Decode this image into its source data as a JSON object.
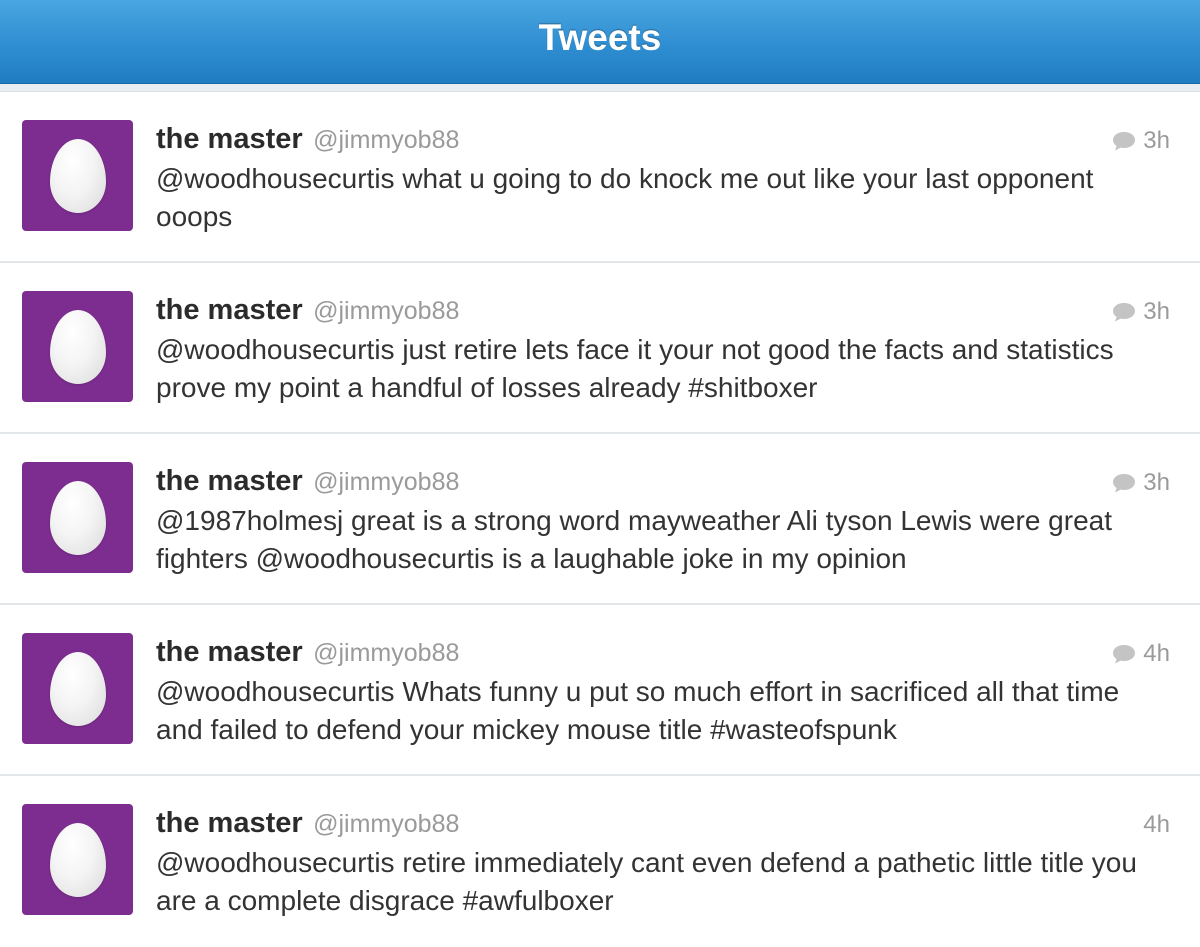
{
  "header": {
    "title": "Tweets"
  },
  "tweets": [
    {
      "name": "the master",
      "handle": "@jimmyob88",
      "time": "3h",
      "has_reply_icon": true,
      "text": "@woodhousecurtis what u going to do knock me out like your last opponent ooops"
    },
    {
      "name": "the master",
      "handle": "@jimmyob88",
      "time": "3h",
      "has_reply_icon": true,
      "text": "@woodhousecurtis just retire lets face it your not good the facts and statistics prove my point a handful of losses already #shitboxer"
    },
    {
      "name": "the master",
      "handle": "@jimmyob88",
      "time": "3h",
      "has_reply_icon": true,
      "text": "@1987holmesj great is a strong word mayweather Ali tyson Lewis were great fighters @woodhousecurtis is a laughable joke in my opinion"
    },
    {
      "name": "the master",
      "handle": "@jimmyob88",
      "time": "4h",
      "has_reply_icon": true,
      "text": "@woodhousecurtis Whats funny u put so much effort in sacrificed all that time and failed to defend your mickey mouse title #wasteofspunk"
    },
    {
      "name": "the master",
      "handle": "@jimmyob88",
      "time": "4h",
      "has_reply_icon": false,
      "text": "@woodhousecurtis retire immediately cant even defend a pathetic little title you are a complete disgrace #awfulboxer"
    }
  ],
  "icons": {
    "avatar": "default-egg-icon",
    "reply": "speech-bubble-icon"
  },
  "colors": {
    "header": "#2f8ed2",
    "avatar_bg": "#7c2d8f",
    "meta_text": "#9a9a9a"
  }
}
